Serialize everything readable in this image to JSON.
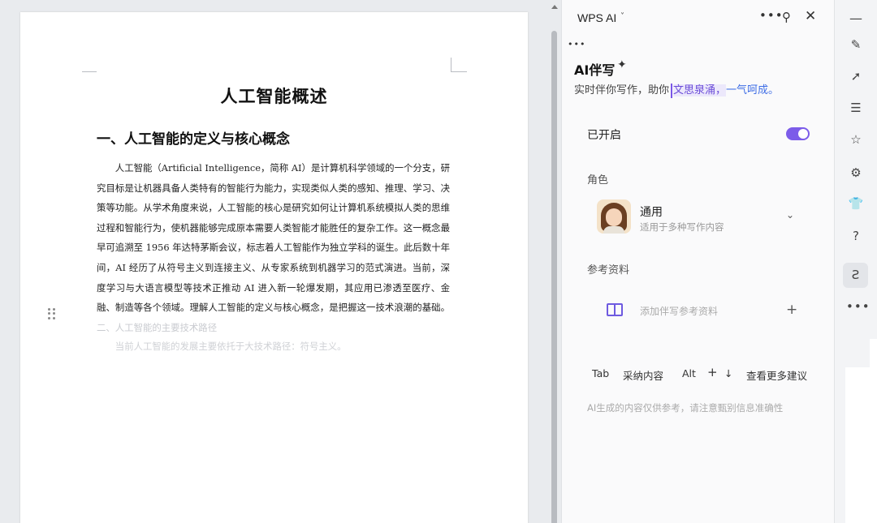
{
  "document": {
    "title": "人工智能概述",
    "heading": "一、人工智能的定义与核心概念",
    "paragraph": "人工智能（Artificial Intelligence，简称 AI）是计算机科学领域的一个分支，研究目标是让机器具备人类特有的智能行为能力，实现类似人类的感知、推理、学习、决策等功能。从学术角度来说，人工智能的核心是研究如何让计算机系统模拟人类的思维过程和智能行为，使机器能够完成原本需要人类智能才能胜任的复杂工作。这一概念最早可追溯至 1956 年达特茅斯会议，标志着人工智能作为独立学科的诞生。此后数十年间，AI 经历了从符号主义到连接主义、从专家系统到机器学习的范式演进。当前，深度学习与大语言模型等技术正推动 AI 进入新一轮爆发期，其应用已渗透至医疗、金融、制造等各个领域。理解人工智能的定义与核心概念，是把握这一技术浪潮的基础。",
    "suggestion_inline": "二、人工智能的主要技术路径",
    "suggestion_next": "当前人工智能的发展主要依托于大技术路径：符号主义。"
  },
  "ai_panel": {
    "title": "WPS AI",
    "title_caret": "˅",
    "more": "•••",
    "pin": "⚲",
    "close": "✕",
    "dots": "•••",
    "companion_title": "AI伴写",
    "sparkle": "✦",
    "subtitle_plain": "实时伴你写作，助你",
    "subtitle_highlight": "文思泉涌，",
    "subtitle_gradient": "一气呵成。",
    "enabled_label": "已开启",
    "toggle_on": true,
    "role_label": "角色",
    "role_name": "通用",
    "role_desc": "适用于多种写作内容",
    "role_chevron": "⌄",
    "ref_label": "参考资料",
    "ref_add": "添加伴写参考资料",
    "ref_plus": "+",
    "kb_tab": "Tab",
    "kb_tab_desc": "采纳内容",
    "kb_alt": "Alt",
    "kb_plus": "+",
    "kb_down": "↓",
    "kb_alt_desc": "查看更多建议",
    "disclaimer": "AI生成的内容仅供参考，请注意甄别信息准确性"
  },
  "right_bar": {
    "minus": "—",
    "pen": "✎",
    "cursor": "➚",
    "sliders": "☰",
    "star": "☆",
    "settings": "⚙",
    "shirt": "👕",
    "help": "?",
    "ai": "Ƨ",
    "more": "•••"
  },
  "colors": {
    "accent": "#7c5ce9",
    "highlight_bg": "#ece8fb",
    "gradient_text": "#3f6ee6"
  }
}
